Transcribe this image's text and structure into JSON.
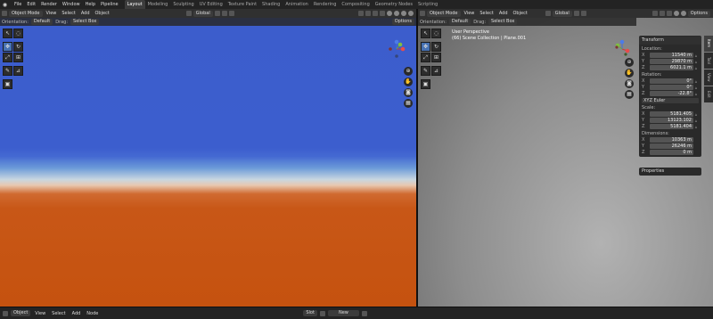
{
  "topbar": {
    "menus": [
      "File",
      "Edit",
      "Render",
      "Window",
      "Help",
      "Pipeline"
    ],
    "workspaces": [
      "Layout",
      "Modeling",
      "Sculpting",
      "UV Editing",
      "Texture Paint",
      "Shading",
      "Animation",
      "Rendering",
      "Compositing",
      "Geometry Nodes",
      "Scripting"
    ],
    "active_workspace": "Layout"
  },
  "left_view": {
    "header": {
      "mode": "Object Mode",
      "menus": [
        "View",
        "Select",
        "Add",
        "Object"
      ],
      "transform": "Global"
    },
    "tool_header": {
      "orientation_label": "Orientation:",
      "orientation": "Default",
      "drag_label": "Drag:",
      "drag": "Select Box",
      "options": "Options"
    }
  },
  "right_view": {
    "header": {
      "mode": "Object Mode",
      "menus": [
        "View",
        "Select",
        "Add",
        "Object"
      ],
      "transform": "Global",
      "options": "Options"
    },
    "tool_header": {
      "orientation_label": "Orientation:",
      "orientation": "Default",
      "drag_label": "Drag:",
      "drag": "Select Box"
    },
    "overlay": {
      "view_name": "User Perspective",
      "collection": "(66) Scene Collection | Plane.001"
    },
    "npanel": {
      "title": "Transform",
      "location_label": "Location:",
      "location": [
        {
          "axis": "X",
          "value": "11540 m"
        },
        {
          "axis": "Y",
          "value": "29870 m"
        },
        {
          "axis": "Z",
          "value": "6021.1 m"
        }
      ],
      "rotation_label": "Rotation:",
      "rotation": [
        {
          "axis": "X",
          "value": "0°"
        },
        {
          "axis": "Y",
          "value": "0°"
        },
        {
          "axis": "Z",
          "value": "-22.8°"
        }
      ],
      "rotation_mode": "XYZ Euler",
      "scale_label": "Scale:",
      "scale": [
        {
          "axis": "X",
          "value": "5181.405"
        },
        {
          "axis": "Y",
          "value": "13123.102"
        },
        {
          "axis": "Z",
          "value": "5181.404"
        }
      ],
      "dimensions_label": "Dimensions:",
      "dimensions": [
        {
          "axis": "X",
          "value": "10363 m"
        },
        {
          "axis": "Y",
          "value": "26246 m"
        },
        {
          "axis": "Z",
          "value": "0 m"
        }
      ],
      "properties_label": "Properties"
    },
    "side_tabs": [
      "Item",
      "Tool",
      "View",
      "Edit"
    ]
  },
  "statusbar": {
    "mode": "Object",
    "menus": [
      "View",
      "Select",
      "Add",
      "Node"
    ],
    "slot": "Slot",
    "new_label": "New"
  },
  "colors": {
    "sky_blue": "#3c5dcc",
    "ground_orange": "#c85717",
    "active_tab": "#4772b3"
  }
}
